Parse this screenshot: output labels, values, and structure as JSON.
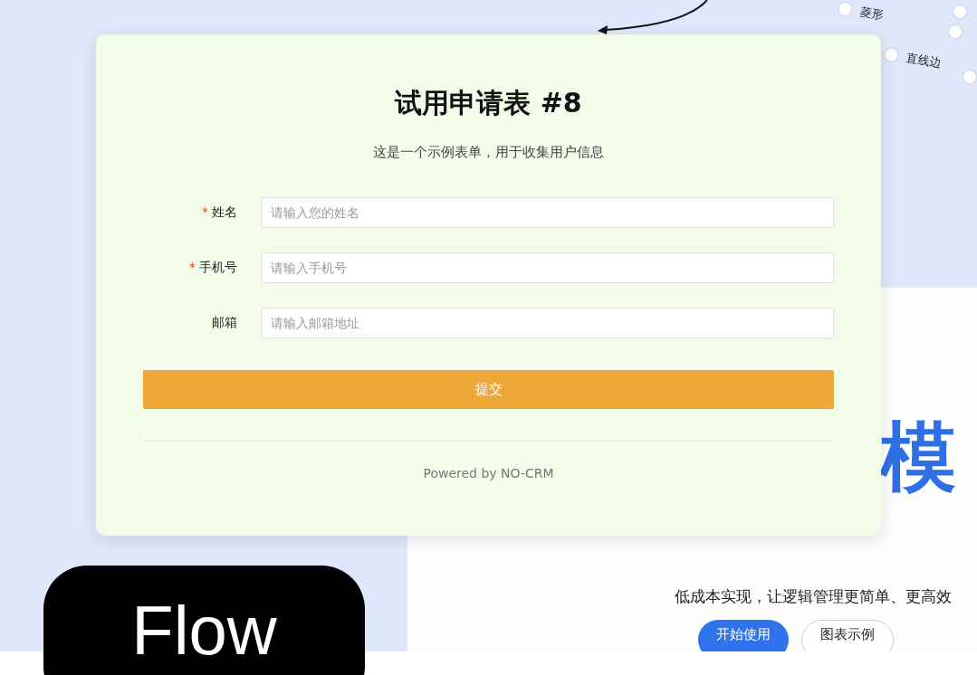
{
  "background_page": {
    "shape_options": [
      {
        "label": "菱形"
      },
      {
        "label": "直线边"
      }
    ],
    "hero_title": "模",
    "tagline": "低成本实现，让逻辑管理更简单、更高效",
    "buttons": [
      {
        "label": "开始使用",
        "kind": "primary"
      },
      {
        "label": "图表示例",
        "kind": "secondary"
      }
    ],
    "logo_text": "Flow"
  },
  "form": {
    "title": "试用申请表 #8",
    "description": "这是一个示例表单，用于收集用户信息",
    "required_mark": "*",
    "fields": [
      {
        "label": "姓名",
        "placeholder": "请输入您的姓名",
        "required": true
      },
      {
        "label": "手机号",
        "placeholder": "请输入手机号",
        "required": true
      },
      {
        "label": "邮箱",
        "placeholder": "请输入邮箱地址",
        "required": false
      }
    ],
    "submit": "提交",
    "footer": "Powered by NO-CRM"
  }
}
